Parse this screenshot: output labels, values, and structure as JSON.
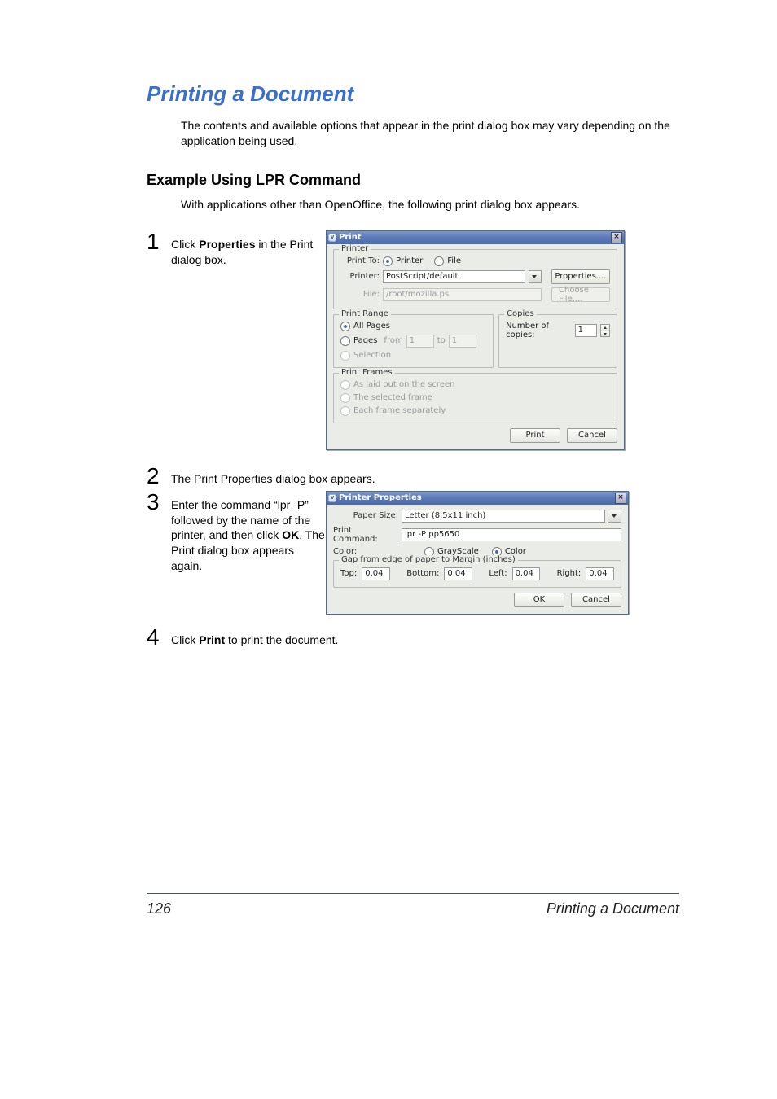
{
  "heading": "Printing a Document",
  "intro": "The contents and available options that appear in the print dialog box may vary depending on the application being used.",
  "subheading": "Example Using LPR Command",
  "subintro": "With applications other than OpenOffice, the following print dialog box appears.",
  "steps": {
    "s1": {
      "num": "1",
      "text_a": "Click ",
      "text_b": "Properties",
      "text_c": " in the Print dialog box."
    },
    "s2": {
      "num": "2",
      "text": "The Print Properties dialog box appears."
    },
    "s3": {
      "num": "3",
      "text_a": "Enter the command “lpr -P” followed by the name of the printer, and then click ",
      "text_b": "OK",
      "text_c": ". The Print dialog box appears again."
    },
    "s4": {
      "num": "4",
      "text_a": "Click ",
      "text_b": "Print",
      "text_c": " to print the document."
    }
  },
  "dlg1": {
    "title": "Print",
    "printer_legend": "Printer",
    "print_to": "Print To:",
    "radio_printer": "Printer",
    "radio_file": "File",
    "printer_label": "Printer:",
    "printer_value": "PostScript/default",
    "properties_btn": "Properties....",
    "file_label": "File:",
    "file_value": "/root/mozilla.ps",
    "choose_file_btn": "Choose File....",
    "range_legend": "Print Range",
    "all_pages": "All Pages",
    "pages_lbl": "Pages",
    "from_lbl": "from",
    "from_val": "1",
    "to_lbl": "to",
    "to_val": "1",
    "selection": "Selection",
    "copies_legend": "Copies",
    "copies_lbl": "Number of copies:",
    "copies_val": "1",
    "frames_legend": "Print Frames",
    "frames_a": "As laid out on the screen",
    "frames_b": "The selected frame",
    "frames_c": "Each frame separately",
    "print_btn": "Print",
    "cancel_btn": "Cancel"
  },
  "dlg2": {
    "title": "Printer Properties",
    "paper_size_lbl": "Paper Size:",
    "paper_size_val": "Letter (8.5x11 inch)",
    "print_cmd_lbl": "Print Command:",
    "print_cmd_val": "lpr -P pp5650",
    "color_lbl": "Color:",
    "grayscale": "GrayScale",
    "color": "Color",
    "gap_legend": "Gap from edge of paper to Margin (inches)",
    "top_lbl": "Top:",
    "top_val": "0.04",
    "bottom_lbl": "Bottom:",
    "bottom_val": "0.04",
    "left_lbl": "Left:",
    "left_val": "0.04",
    "right_lbl": "Right:",
    "right_val": "0.04",
    "ok_btn": "OK",
    "cancel_btn": "Cancel"
  },
  "footer": {
    "page": "126",
    "title": "Printing a Document"
  }
}
